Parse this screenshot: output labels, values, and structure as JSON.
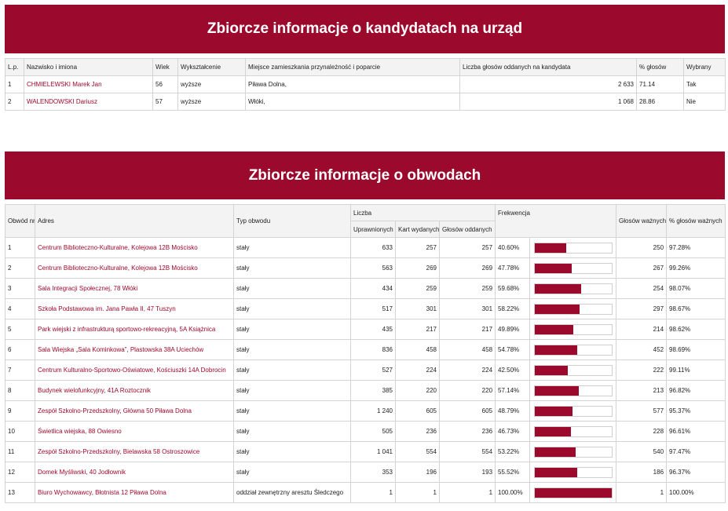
{
  "section1": {
    "title": "Zbiorcze informacje o kandydatach na urząd",
    "headers": {
      "lp": "L.p.",
      "name": "Nazwisko i imiona",
      "age": "Wiek",
      "education": "Wykształcenie",
      "residence": "Miejsce zamieszkania przynależność i poparcie",
      "votes": "Liczba głosów oddanych na kandydata",
      "percent": "% głosów",
      "elected": "Wybrany"
    },
    "rows": [
      {
        "lp": "1",
        "name": "CHMIELEWSKI Marek Jan",
        "age": "56",
        "education": "wyższe",
        "residence": "Piława Dolna,",
        "votes": "2 633",
        "percent": "71.14",
        "elected": "Tak"
      },
      {
        "lp": "2",
        "name": "WALENDOWSKI Dariusz",
        "age": "57",
        "education": "wyższe",
        "residence": "Włóki,",
        "votes": "1 068",
        "percent": "28.86",
        "elected": "Nie"
      }
    ]
  },
  "section2": {
    "title": "Zbiorcze informacje o obwodach",
    "headers": {
      "district": "Obwód nr",
      "address": "Adres",
      "type": "Typ obwodu",
      "count": "Liczba",
      "eligible": "Uprawnionych",
      "cards": "Kart wydanych",
      "cast": "Głosów oddanych",
      "turnout": "Frekwencja",
      "valid": "Głosów ważnych",
      "valid_pct": "% głosów ważnych"
    },
    "rows": [
      {
        "nr": "1",
        "address": "Centrum Biblioteczno-Kulturalne, Kolejowa 12B Mościsko",
        "type": "stały",
        "eligible": "633",
        "cards": "257",
        "cast": "257",
        "turnout": "40.60%",
        "turnout_value": 40.6,
        "valid": "250",
        "valid_pct": "97.28%"
      },
      {
        "nr": "2",
        "address": "Centrum Biblioteczno-Kulturalne, Kolejowa 12B Mościsko",
        "type": "stały",
        "eligible": "563",
        "cards": "269",
        "cast": "269",
        "turnout": "47.78%",
        "turnout_value": 47.78,
        "valid": "267",
        "valid_pct": "99.26%"
      },
      {
        "nr": "3",
        "address": "Sala Integracji Społecznej, 78 Włóki",
        "type": "stały",
        "eligible": "434",
        "cards": "259",
        "cast": "259",
        "turnout": "59.68%",
        "turnout_value": 59.68,
        "valid": "254",
        "valid_pct": "98.07%"
      },
      {
        "nr": "4",
        "address": "Szkoła Podstawowa im. Jana Pawła II, 47 Tuszyn",
        "type": "stały",
        "eligible": "517",
        "cards": "301",
        "cast": "301",
        "turnout": "58.22%",
        "turnout_value": 58.22,
        "valid": "297",
        "valid_pct": "98.67%"
      },
      {
        "nr": "5",
        "address": "Park wiejski z infrastrukturą sportowo-rekreacyjną, 5A Książnica",
        "type": "stały",
        "eligible": "435",
        "cards": "217",
        "cast": "217",
        "turnout": "49.89%",
        "turnout_value": 49.89,
        "valid": "214",
        "valid_pct": "98.62%"
      },
      {
        "nr": "6",
        "address": "Sala Wiejska „Sala Kominkowa”, Plastowska 38A Uciechów",
        "type": "stały",
        "eligible": "836",
        "cards": "458",
        "cast": "458",
        "turnout": "54.78%",
        "turnout_value": 54.78,
        "valid": "452",
        "valid_pct": "98.69%"
      },
      {
        "nr": "7",
        "address": "Centrum Kulturalno-Sportowo-Oświatowe, Kościuszki 14A Dobrocin",
        "type": "stały",
        "eligible": "527",
        "cards": "224",
        "cast": "224",
        "turnout": "42.50%",
        "turnout_value": 42.5,
        "valid": "222",
        "valid_pct": "99.11%"
      },
      {
        "nr": "8",
        "address": "Budynek wielofunkcyjny, 41A Roztocznik",
        "type": "stały",
        "eligible": "385",
        "cards": "220",
        "cast": "220",
        "turnout": "57.14%",
        "turnout_value": 57.14,
        "valid": "213",
        "valid_pct": "96.82%"
      },
      {
        "nr": "9",
        "address": "Zespół Szkolno-Przedszkolny, Główna 50 Piława Dolna",
        "type": "stały",
        "eligible": "1 240",
        "cards": "605",
        "cast": "605",
        "turnout": "48.79%",
        "turnout_value": 48.79,
        "valid": "577",
        "valid_pct": "95.37%"
      },
      {
        "nr": "10",
        "address": "Świetlica wiejska, 88 Owiesno",
        "type": "stały",
        "eligible": "505",
        "cards": "236",
        "cast": "236",
        "turnout": "46.73%",
        "turnout_value": 46.73,
        "valid": "228",
        "valid_pct": "96.61%"
      },
      {
        "nr": "11",
        "address": "Zespół Szkolno-Przedszkolny, Bielawska 58 Ostroszowice",
        "type": "stały",
        "eligible": "1 041",
        "cards": "554",
        "cast": "554",
        "turnout": "53.22%",
        "turnout_value": 53.22,
        "valid": "540",
        "valid_pct": "97.47%"
      },
      {
        "nr": "12",
        "address": "Domek Myśliwski, 40 Jodłownik",
        "type": "stały",
        "eligible": "353",
        "cards": "196",
        "cast": "193",
        "turnout": "55.52%",
        "turnout_value": 55.52,
        "valid": "186",
        "valid_pct": "96.37%"
      },
      {
        "nr": "13",
        "address": "Biuro Wychowawcy, Błotnista 12 Piława Dolna",
        "type": "oddział zewnętrzny aresztu Śledczego",
        "eligible": "1",
        "cards": "1",
        "cast": "1",
        "turnout": "100.00%",
        "turnout_value": 100.0,
        "valid": "1",
        "valid_pct": "100.00%"
      }
    ]
  },
  "colors": {
    "accent": "#9b0a2c",
    "header_bg": "#f3f3f3",
    "border": "#d4d4d4"
  }
}
